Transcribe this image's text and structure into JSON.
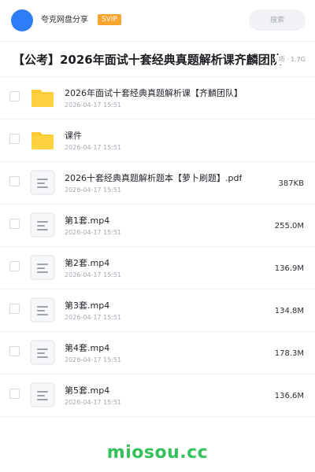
{
  "header": {
    "brand": "夸克网盘分享",
    "badge": "SVIP",
    "search_placeholder": "搜索"
  },
  "share": {
    "title": "【公考】2026年面试十套经典真题解析课齐麟团队",
    "meta": "项 · 1.7G"
  },
  "files": [
    {
      "type": "folder",
      "name": "2026年面试十套经典真题解析课【齐麟团队】",
      "date": "2026-04-17 15:51",
      "size": ""
    },
    {
      "type": "folder",
      "name": "课件",
      "date": "2026-04-17 15:51",
      "size": ""
    },
    {
      "type": "doc",
      "name": "2026十套经典真题解析题本【萝卜刷题】.pdf",
      "date": "2026-04-17 15:51",
      "size": "387KB"
    },
    {
      "type": "doc",
      "name": "第1套.mp4",
      "date": "2026-04-17 15:51",
      "size": "255.0M"
    },
    {
      "type": "doc",
      "name": "第2套.mp4",
      "date": "2026-04-17 15:51",
      "size": "136.9M"
    },
    {
      "type": "doc",
      "name": "第3套.mp4",
      "date": "2026-04-17 15:51",
      "size": "134.8M"
    },
    {
      "type": "doc",
      "name": "第4套.mp4",
      "date": "2026-04-17 15:51",
      "size": "178.3M"
    },
    {
      "type": "doc",
      "name": "第5套.mp4",
      "date": "2026-04-17 15:51",
      "size": "136.6M"
    }
  ],
  "watermark": "miosou.cc",
  "colors": {
    "accent": "#2f7df6",
    "svip": "#f7a52c",
    "folder": "#ffc933",
    "watermark": "#34c05b"
  },
  "icons": {
    "folder": "folder-icon",
    "doc": "document-icon"
  }
}
